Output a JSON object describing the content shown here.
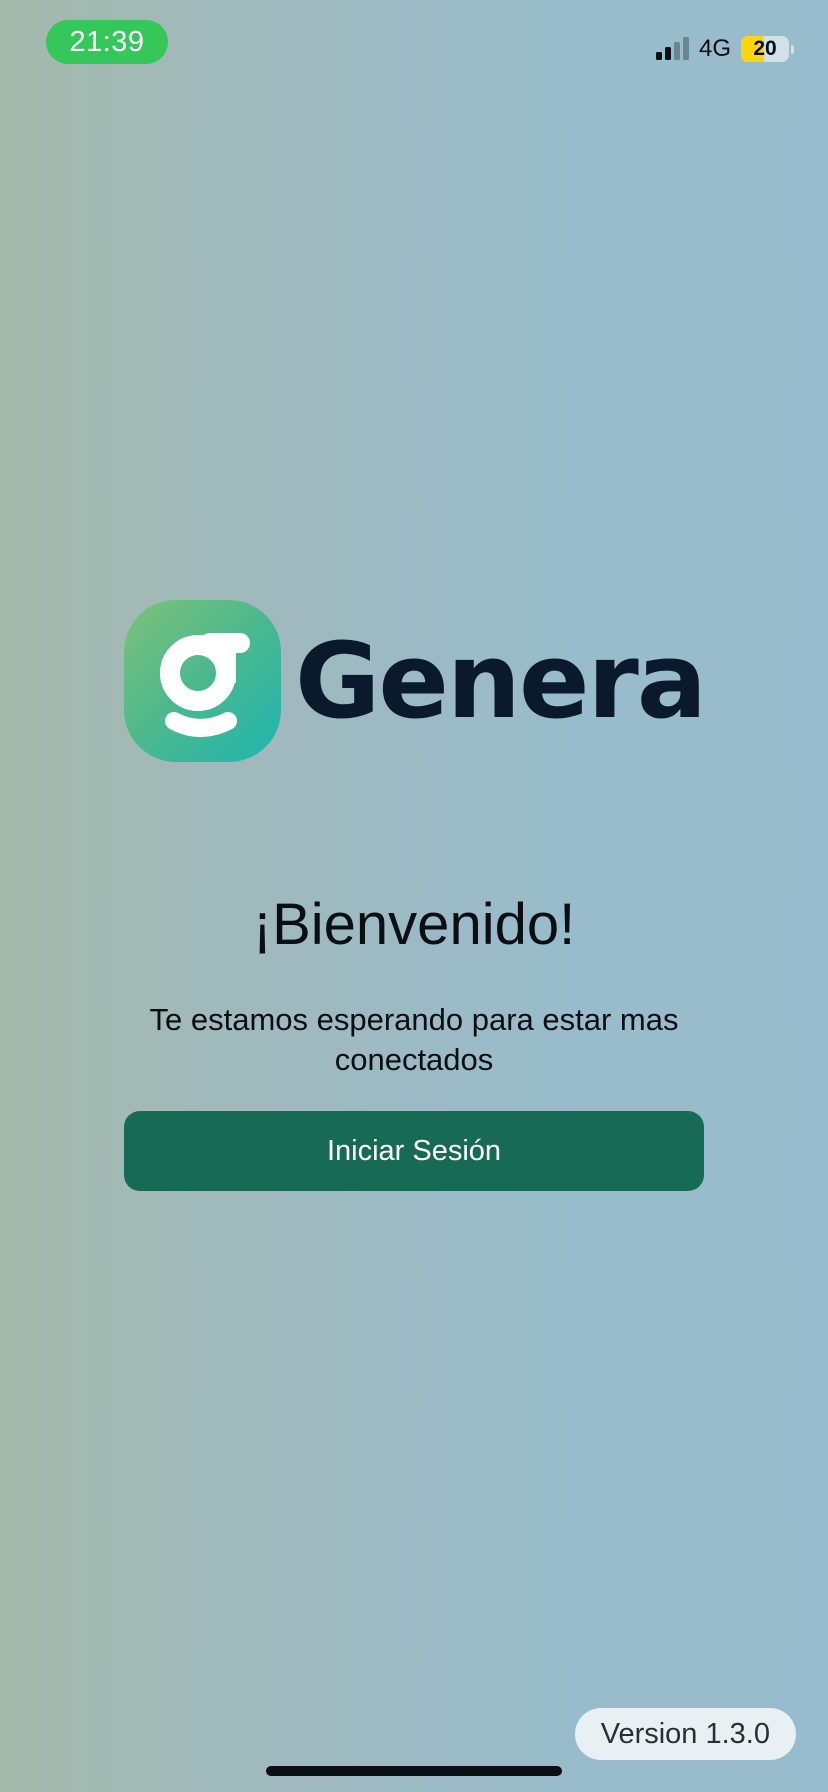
{
  "status_bar": {
    "time": "21:39",
    "network": "4G",
    "battery_level": "20",
    "battery_fraction": 0.2,
    "colors": {
      "time_pill": "#35c759",
      "battery_fill": "#ffd60a"
    }
  },
  "logo": {
    "wordmark": "Genera",
    "icon": "genera-g-icon",
    "colors": {
      "badge_start": "#7dc27a",
      "badge_end": "#1fb5b2",
      "wordmark": "#0a1a2c"
    }
  },
  "welcome": {
    "title": "¡Bienvenido!",
    "subtitle": "Te estamos esperando para estar mas conectados"
  },
  "actions": {
    "login_label": "Iniciar Sesión",
    "login_color": "#176b55"
  },
  "footer": {
    "version": "Version 1.3.0"
  }
}
